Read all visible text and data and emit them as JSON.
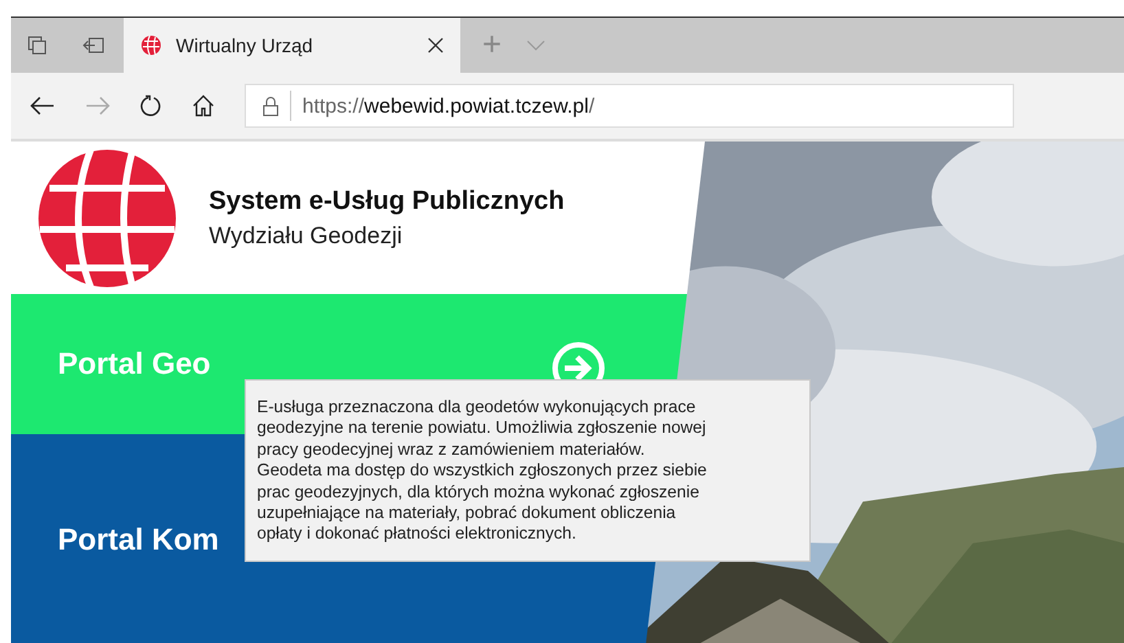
{
  "tab_bar": {
    "tabs": [
      {
        "title": "Wirtualny Urząd",
        "selected": true
      }
    ],
    "new_tab": "+"
  },
  "address_bar": {
    "url_prefix": "https://",
    "url_host": "webewid.powiat.tczew.pl",
    "url_suffix": "/"
  },
  "header": {
    "title": "System e-Usług Publicznych",
    "subtitle": "Wydziału Geodezji"
  },
  "portals": [
    {
      "label": "Portal Geo",
      "color": "#1de870",
      "arrow": true
    },
    {
      "label": "Portal Kom",
      "color": "#0a5aa0",
      "arrow": false
    }
  ],
  "tooltip": {
    "lines": [
      "E-usługa przeznaczona dla geodetów wykonujących prace",
      "geodezyjne na terenie powiatu. Umożliwia zgłoszenie nowej",
      "pracy geodecyjnej wraz z zamówieniem materiałów.",
      "Geodeta ma dostęp do wszystkich zgłoszonych przez siebie",
      "prac geodezyjnych, dla których można wykonać zgłoszenie",
      "uzupełniające na materiały, pobrać dokument obliczenia",
      "opłaty i dokonać płatności elektronicznych."
    ]
  }
}
